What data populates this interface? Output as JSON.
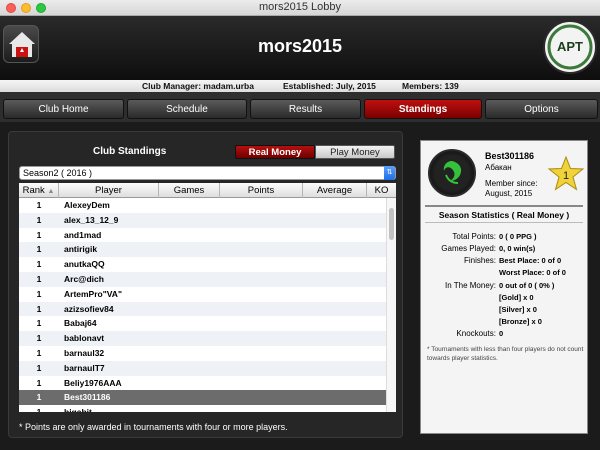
{
  "window": {
    "title": "mors2015 Lobby"
  },
  "header": {
    "club_name": "mors2015",
    "logo_text": "APT"
  },
  "infobar": {
    "club_manager": "Club Manager: madam.urba",
    "established": "Established: July, 2015",
    "members": "Members: 139"
  },
  "tabs": [
    {
      "label": "Club Home"
    },
    {
      "label": "Schedule"
    },
    {
      "label": "Results"
    },
    {
      "label": "Standings"
    },
    {
      "label": "Options"
    }
  ],
  "standings": {
    "title": "Club Standings",
    "real_money_label": "Real Money",
    "play_money_label": "Play Money",
    "season": "Season2 ( 2016 )",
    "columns": [
      "Rank",
      "Player",
      "Games",
      "Points",
      "Average",
      "KO"
    ],
    "rows": [
      {
        "rank": "1",
        "player": "AlexeyDem"
      },
      {
        "rank": "1",
        "player": "alex_13_12_9"
      },
      {
        "rank": "1",
        "player": "and1mad"
      },
      {
        "rank": "1",
        "player": "antirigik"
      },
      {
        "rank": "1",
        "player": "anutkaQQ"
      },
      {
        "rank": "1",
        "player": "Arc@dich"
      },
      {
        "rank": "1",
        "player": "ArtemPro\"VA\""
      },
      {
        "rank": "1",
        "player": "azizsofiev84"
      },
      {
        "rank": "1",
        "player": "Babaj64"
      },
      {
        "rank": "1",
        "player": "bablonavt"
      },
      {
        "rank": "1",
        "player": "barnaul32"
      },
      {
        "rank": "1",
        "player": "barnaulT7"
      },
      {
        "rank": "1",
        "player": "Beliy1976AAA"
      },
      {
        "rank": "1",
        "player": "Best301186"
      },
      {
        "rank": "1",
        "player": "bigabit"
      }
    ],
    "footnote": "* Points are only awarded in tournaments with four or more players."
  },
  "player": {
    "name": "Best301186",
    "city": "Абакан",
    "member_since_label": "Member since:",
    "member_since": "August, 2015",
    "rank_badge": "1",
    "stats_title": "Season Statistics ( Real Money )",
    "total_points_label": "Total Points:",
    "total_points": "0  ( 0 PPG )",
    "games_played_label": "Games Played:",
    "games_played": "0, 0 win(s)",
    "finishes_label": "Finishes:",
    "best_place": "Best Place: 0 of 0",
    "worst_place": "Worst Place: 0 of 0",
    "in_the_money_label": "In The Money:",
    "in_the_money": "0 out of 0  ( 0% )",
    "gold": "[Gold] x 0",
    "silver": "[Silver] x 0",
    "bronze": "[Bronze] x 0",
    "knockouts_label": "Knockouts:",
    "knockouts": "0",
    "note": "* Tournaments with less than four players do not count towards player statistics."
  },
  "colors": {
    "accent_red": "#b51010",
    "selected_row": "#6c6c6c"
  }
}
